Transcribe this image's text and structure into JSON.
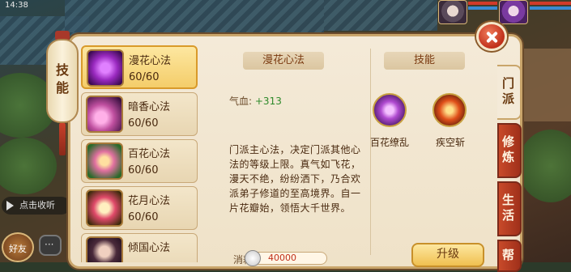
{
  "statusbar": {
    "time": "14:38"
  },
  "chat": {
    "toggle_label": "点击收听",
    "avatar_label": "好友"
  },
  "panel": {
    "tab_label": "技能"
  },
  "skills": [
    {
      "name": "漫花心法",
      "level": "60/60",
      "selected": true
    },
    {
      "name": "暗香心法",
      "level": "60/60",
      "selected": false
    },
    {
      "name": "百花心法",
      "level": "60/60",
      "selected": false
    },
    {
      "name": "花月心法",
      "level": "60/60",
      "selected": false
    },
    {
      "name": "倾国心法",
      "level": "",
      "selected": false
    }
  ],
  "detail": {
    "title": "漫花心法",
    "stat_label": "气血:",
    "stat_value": "+313",
    "description": "门派主心法，决定门派其他心法的等级上限。真气如飞花，漫天不绝，纷纷洒下，乃合欢派弟子修道的至高境界。自一片花瓣始，领悟大千世界。",
    "cost_label": "消耗",
    "cost_value": "40000"
  },
  "abilities": {
    "title": "技能",
    "items": [
      {
        "name": "百花缭乱",
        "icon": "flower-burst-icon"
      },
      {
        "name": "疾空斩",
        "icon": "fire-slash-icon"
      }
    ]
  },
  "upgrade_label": "升级",
  "side_tabs": [
    "门派",
    "修炼",
    "生活",
    "帮"
  ],
  "colors": {
    "selected_bg": "#f4cd6a",
    "stat_value": "#2e8a2a",
    "tab_red": "#c84a2a"
  }
}
